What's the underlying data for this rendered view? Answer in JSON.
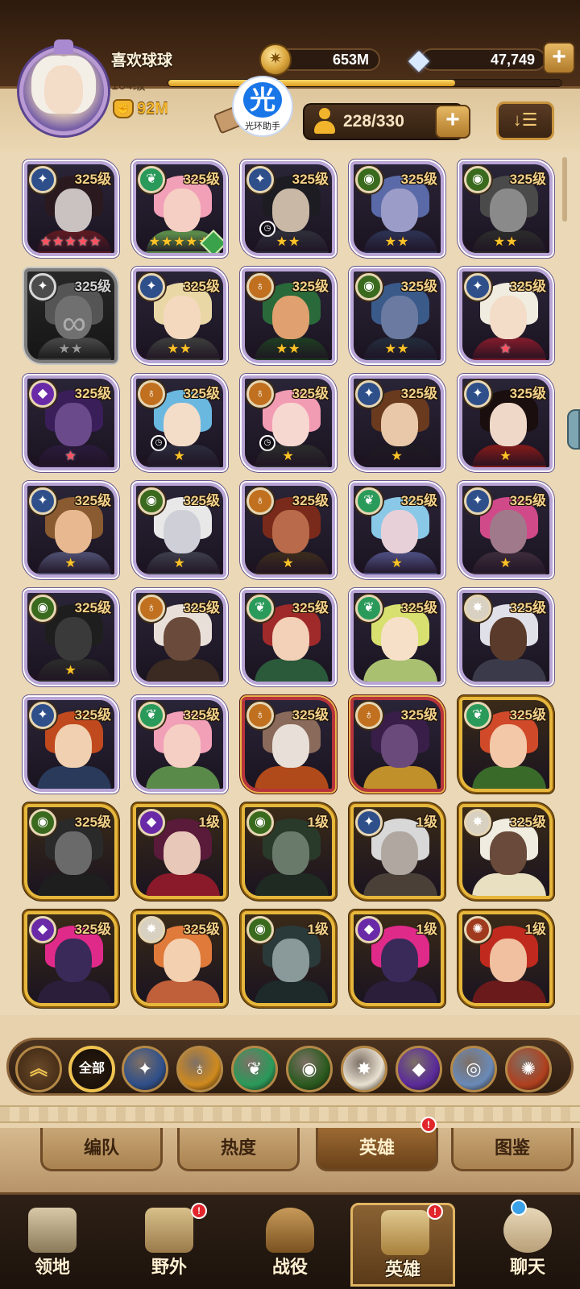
{
  "player": {
    "name": "喜欢球球",
    "level": "164级",
    "exp_progress": 0.73,
    "power": "92M"
  },
  "resources": {
    "gold": "653M",
    "diamonds": "47,749",
    "plus": "+"
  },
  "helper": {
    "icon": "光",
    "label": "光环助手"
  },
  "hero_count": {
    "text": "228/330",
    "plus": "+"
  },
  "sort_icon": "↓☰",
  "heroes": [
    {
      "level": "325级",
      "faction": "lightbearer",
      "stars": "★★★★★",
      "star_color": "red",
      "frame": "purple",
      "skin": "#c9c2c0",
      "hair": "#2a1a20",
      "cloth": "#5a1a22"
    },
    {
      "level": "325级",
      "faction": "wilder",
      "stars": "★★★★★",
      "star_color": "gold",
      "frame": "purple",
      "skin": "#f5cfc3",
      "hair": "#f2a0b8",
      "cloth": "#5a8a4a",
      "hourglass": true
    },
    {
      "level": "325级",
      "faction": "lightbearer",
      "stars": "★★",
      "star_color": "gold",
      "frame": "purple",
      "skin": "#c9b8a6",
      "hair": "#1c1c22",
      "cloth": "#2d2d38",
      "timer": true
    },
    {
      "level": "325级",
      "faction": "graveborn",
      "stars": "★★",
      "star_color": "gold",
      "frame": "purple",
      "skin": "#9c9cc8",
      "hair": "#5a6aa8",
      "cloth": "#2c3050"
    },
    {
      "level": "325级",
      "faction": "graveborn",
      "stars": "★★",
      "star_color": "gold",
      "frame": "purple",
      "skin": "#8a8a8a",
      "hair": "#4a4a4a",
      "cloth": "#2a2a2a"
    },
    {
      "level": "325级",
      "faction": "lightbearer",
      "stars": "★★",
      "star_color": "grey",
      "frame": "grey",
      "skin": "#707070",
      "hair": "#555555",
      "cloth": "#444444",
      "chain": true
    },
    {
      "level": "325级",
      "faction": "lightbearer",
      "stars": "★★",
      "star_color": "gold",
      "frame": "purple",
      "skin": "#f4d9bf",
      "hair": "#e9d8a6",
      "cloth": "#3a3a3a"
    },
    {
      "level": "325级",
      "faction": "maulers",
      "stars": "★★",
      "star_color": "gold",
      "frame": "purple",
      "skin": "#e0a070",
      "hair": "#2a6a3a",
      "cloth": "#1e3a22"
    },
    {
      "level": "325级",
      "faction": "graveborn",
      "stars": "★★",
      "star_color": "gold",
      "frame": "purple",
      "skin": "#6a7aa0",
      "hair": "#3a5a8a",
      "cloth": "#222a3a"
    },
    {
      "level": "325级",
      "faction": "lightbearer",
      "stars": "★",
      "star_color": "red",
      "frame": "purple",
      "skin": "#f3dcc8",
      "hair": "#f1ece0",
      "cloth": "#7a1a2a"
    },
    {
      "level": "325级",
      "faction": "hypogean",
      "stars": "★",
      "star_color": "red",
      "frame": "purple",
      "skin": "#6a4a8a",
      "hair": "#3a1e5a",
      "cloth": "#2a1a3a"
    },
    {
      "level": "325级",
      "faction": "maulers",
      "stars": "★",
      "star_color": "gold",
      "frame": "purple",
      "skin": "#f3dcc8",
      "hair": "#6ab8e0",
      "cloth": "#2a2a3a",
      "timer": true
    },
    {
      "level": "325级",
      "faction": "maulers",
      "stars": "★",
      "star_color": "gold",
      "frame": "purple",
      "skin": "#f7d8d0",
      "hair": "#f29cb4",
      "cloth": "#2a2a2a",
      "timer": true
    },
    {
      "level": "325级",
      "faction": "lightbearer",
      "stars": "★",
      "star_color": "gold",
      "frame": "purple",
      "skin": "#e8c8a8",
      "hair": "#6a3a1e",
      "cloth": "#1e1a22"
    },
    {
      "level": "325级",
      "faction": "lightbearer",
      "stars": "★",
      "star_color": "gold",
      "frame": "purple",
      "skin": "#f0d8c8",
      "hair": "#1a0e0e",
      "cloth": "#7a1a1a"
    },
    {
      "level": "325级",
      "faction": "lightbearer",
      "stars": "★",
      "star_color": "gold",
      "frame": "purple",
      "skin": "#e8b890",
      "hair": "#8a5a30",
      "cloth": "#4a4a6a"
    },
    {
      "level": "325级",
      "faction": "graveborn",
      "stars": "★",
      "star_color": "gold",
      "frame": "purple",
      "skin": "#cfcfd8",
      "hair": "#e8e8e8",
      "cloth": "#3a3a48"
    },
    {
      "level": "325级",
      "faction": "maulers",
      "stars": "★",
      "star_color": "gold",
      "frame": "purple",
      "skin": "#b86a4a",
      "hair": "#7a2a1a",
      "cloth": "#3a2a1e"
    },
    {
      "level": "325级",
      "faction": "wilder",
      "stars": "★",
      "star_color": "gold",
      "frame": "purple",
      "skin": "#e8d0d8",
      "hair": "#8ac8e8",
      "cloth": "#4a4a7a"
    },
    {
      "level": "325级",
      "faction": "lightbearer",
      "stars": "★",
      "star_color": "gold",
      "frame": "purple",
      "skin": "#a07a8a",
      "hair": "#d04a8a",
      "cloth": "#3a2a3a"
    },
    {
      "level": "325级",
      "faction": "graveborn",
      "stars": "★",
      "star_color": "gold",
      "frame": "purple",
      "skin": "#3a3a3a",
      "hair": "#1e1e1e",
      "cloth": "#2a2a2a"
    },
    {
      "level": "325级",
      "faction": "maulers",
      "stars": "",
      "star_color": "gold",
      "frame": "purple",
      "skin": "#6a4a3a",
      "hair": "#e8e0d8",
      "cloth": "#3a2a22"
    },
    {
      "level": "325级",
      "faction": "wilder",
      "stars": "",
      "star_color": "gold",
      "frame": "purple",
      "skin": "#f3d0b8",
      "hair": "#a02a2a",
      "cloth": "#2a5a3a"
    },
    {
      "level": "325级",
      "faction": "wilder",
      "stars": "",
      "star_color": "gold",
      "frame": "purple",
      "skin": "#f6e0c8",
      "hair": "#d8e070",
      "cloth": "#a8c070"
    },
    {
      "level": "325级",
      "faction": "celestial",
      "stars": "",
      "star_color": "gold",
      "frame": "purple",
      "skin": "#5a3a2a",
      "hair": "#e0e0e8",
      "cloth": "#3a3a4a"
    },
    {
      "level": "325级",
      "faction": "lightbearer",
      "stars": "",
      "star_color": "gold",
      "frame": "purple",
      "skin": "#f0d0b0",
      "hair": "#c04a1e",
      "cloth": "#2a3a5a"
    },
    {
      "level": "325级",
      "faction": "wilder",
      "stars": "",
      "star_color": "gold",
      "frame": "purple",
      "skin": "#f5cfc3",
      "hair": "#f2a0b8",
      "cloth": "#5a8a4a"
    },
    {
      "level": "325级",
      "faction": "maulers",
      "stars": "",
      "star_color": "gold",
      "frame": "red",
      "skin": "#e8e0d8",
      "hair": "#8a6a5a",
      "cloth": "#b04a1a"
    },
    {
      "level": "325级",
      "faction": "maulers",
      "stars": "",
      "star_color": "gold",
      "frame": "red",
      "skin": "#6a4a7a",
      "hair": "#3a1e4a",
      "cloth": "#c0902a"
    },
    {
      "level": "325级",
      "faction": "wilder",
      "stars": "",
      "star_color": "gold",
      "frame": "gold",
      "skin": "#f3c8a8",
      "hair": "#d04a2a",
      "cloth": "#3a6a2a"
    },
    {
      "level": "325级",
      "faction": "graveborn",
      "stars": "",
      "star_color": "gold",
      "frame": "gold",
      "skin": "#6a6a6a",
      "hair": "#2a2a2a",
      "cloth": "#1e1e1e"
    },
    {
      "level": "1级",
      "faction": "hypogean",
      "stars": "",
      "star_color": "gold",
      "frame": "gold",
      "skin": "#e8c8b8",
      "hair": "#5a1a3a",
      "cloth": "#8a1a2a"
    },
    {
      "level": "1级",
      "faction": "graveborn",
      "stars": "",
      "star_color": "gold",
      "frame": "gold",
      "skin": "#6a7a6a",
      "hair": "#2a3a2a",
      "cloth": "#1e2a22"
    },
    {
      "level": "1级",
      "faction": "lightbearer",
      "stars": "",
      "star_color": "gold",
      "frame": "gold",
      "skin": "#b0a8a0",
      "hair": "#d8d8d8",
      "cloth": "#4a4038"
    },
    {
      "level": "325级",
      "faction": "celestial",
      "stars": "",
      "star_color": "gold",
      "frame": "gold",
      "skin": "#6a4a3a",
      "hair": "#f0ece0",
      "cloth": "#e8e0c0"
    },
    {
      "level": "325级",
      "faction": "hypogean",
      "stars": "",
      "star_color": "gold",
      "frame": "gold",
      "skin": "#3a2a5a",
      "hair": "#e02a8a",
      "cloth": "#2a1e3a"
    },
    {
      "level": "325级",
      "faction": "celestial",
      "stars": "",
      "star_color": "gold",
      "frame": "gold",
      "skin": "#f3d0b0",
      "hair": "#e07a3a",
      "cloth": "#c0603a"
    },
    {
      "level": "1级",
      "faction": "graveborn",
      "stars": "",
      "star_color": "gold",
      "frame": "gold",
      "skin": "#8a9a9a",
      "hair": "#2a3a3a",
      "cloth": "#1e2a2a"
    },
    {
      "level": "1级",
      "faction": "hypogean",
      "stars": "",
      "star_color": "gold",
      "frame": "gold",
      "skin": "#3a2a5a",
      "hair": "#e02a8a",
      "cloth": "#2a1e3a"
    },
    {
      "level": "1级",
      "faction": "dimensional",
      "stars": "",
      "star_color": "gold",
      "frame": "gold",
      "skin": "#f0c0a0",
      "hair": "#c02a1e",
      "cloth": "#6a1a1a"
    }
  ],
  "faction_colors": {
    "lightbearer": "#2e4f8a",
    "wilder": "#2a9a5a",
    "maulers": "#c0701e",
    "graveborn": "#3a6a1e",
    "celestial": "#d8d0c0",
    "hypogean": "#6a2aa8",
    "dimensional": "#a03a1e"
  },
  "faction_glyphs": {
    "lightbearer": "✦",
    "wilder": "❦",
    "maulers": "♁",
    "graveborn": "◉",
    "celestial": "✸",
    "hypogean": "◆",
    "dimensional": "✺"
  },
  "filters": {
    "up_icon": "︽",
    "all_label": "全部",
    "items": [
      {
        "name": "lightbearer-filter",
        "glyph": "✦",
        "color": "#2e4f8a"
      },
      {
        "name": "maulers-filter",
        "glyph": "♁",
        "color": "#d08a1e"
      },
      {
        "name": "wilder-filter",
        "glyph": "❦",
        "color": "#2a9a5a"
      },
      {
        "name": "graveborn-filter",
        "glyph": "◉",
        "color": "#2a5a1e"
      },
      {
        "name": "celestial-filter",
        "glyph": "✸",
        "color": "#e8e0d0"
      },
      {
        "name": "hypogean-filter",
        "glyph": "◆",
        "color": "#5a2a9a"
      },
      {
        "name": "dimensional-filter",
        "glyph": "◎",
        "color": "#6a8ab8"
      },
      {
        "name": "hypogean-red-filter",
        "glyph": "✺",
        "color": "#b0401e"
      }
    ]
  },
  "tabs": {
    "formation": "编队",
    "popularity": "热度",
    "heroes": "英雄",
    "heroes_badge": "!",
    "codex": "图鉴"
  },
  "nav": {
    "territory": "领地",
    "wilderness": "野外",
    "wilderness_badge": "!",
    "campaign": "战役",
    "heroes": "英雄",
    "heroes_badge": "!",
    "chat": "聊天"
  }
}
